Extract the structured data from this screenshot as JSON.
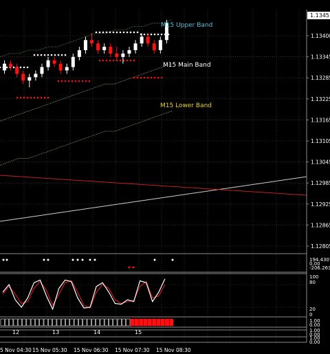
{
  "colors": {
    "background": "#000000",
    "grid": "#4a4a4a",
    "separator": "#8c8c8c",
    "text": "#ffffff",
    "bull": "#ffffff",
    "bear": "#ff1010",
    "upper_band_label": "#4fc3d8",
    "main_band_label": "#ffffff",
    "lower_band_label": "#e6d23a",
    "band_dots": "#c8c8a0",
    "trend_white": "#d0d0d0",
    "trend_red": "#c02020",
    "stoch_main": "#ffffff",
    "stoch_signal": "#d21a1a",
    "price_tag_bg": "#ffffff",
    "price_tag_text": "#000000"
  },
  "price_axis": {
    "current_price": "1.13457",
    "labels": [
      "1.13400",
      "1.13345",
      "1.13285",
      "1.13225",
      "1.13165",
      "1.13105",
      "1.13045",
      "1.12985",
      "1.12925",
      "1.12865",
      "1.12805"
    ]
  },
  "band_labels": {
    "upper": "M15 Upper Band",
    "main": "M15 Main Band",
    "lower": "M15 Lower Band"
  },
  "indicator_axis": {
    "cci_levels": [
      "194.4307",
      "0.00",
      "-206.263"
    ],
    "stoch_levels": [
      "100",
      "80",
      "20",
      "0"
    ],
    "bar_scale": [
      "1.00",
      "0.00"
    ],
    "empty1": [
      "1.00",
      "0.00"
    ],
    "empty2": [
      "1.00",
      "0.00"
    ]
  },
  "date_axis": {
    "day_labels": [
      "12",
      "13",
      "14",
      "15"
    ],
    "time_labels": [
      "5 Nov 04:30",
      "15 Nov 05:30",
      "15 Nov 06:30",
      "15 Nov 07:30",
      "15 Nov 08:30"
    ]
  },
  "chart_data": {
    "type": "candlestick",
    "symbol_timeframe": "M15",
    "ylim": [
      1.1277,
      1.1349
    ],
    "current_price": 1.13457,
    "candles": [
      [
        1.1331,
        1.1334,
        1.133,
        1.1333
      ],
      [
        1.1333,
        1.1334,
        1.1331,
        1.1332
      ],
      [
        1.1332,
        1.1333,
        1.1329,
        1.133
      ],
      [
        1.133,
        1.1331,
        1.1327,
        1.1328
      ],
      [
        1.1328,
        1.133,
        1.1326,
        1.1329
      ],
      [
        1.1329,
        1.1331,
        1.1328,
        1.133
      ],
      [
        1.133,
        1.1333,
        1.1329,
        1.1332
      ],
      [
        1.1332,
        1.1335,
        1.1331,
        1.1334
      ],
      [
        1.1334,
        1.1335,
        1.1332,
        1.1333
      ],
      [
        1.1333,
        1.1334,
        1.133,
        1.1331
      ],
      [
        1.1331,
        1.1333,
        1.133,
        1.1332
      ],
      [
        1.1332,
        1.1336,
        1.1331,
        1.1335
      ],
      [
        1.1335,
        1.1338,
        1.1334,
        1.1337
      ],
      [
        1.1337,
        1.1341,
        1.1336,
        1.134
      ],
      [
        1.134,
        1.1342,
        1.1338,
        1.1339
      ],
      [
        1.1339,
        1.134,
        1.1336,
        1.1337
      ],
      [
        1.1337,
        1.1339,
        1.1336,
        1.1338
      ],
      [
        1.1338,
        1.1339,
        1.1335,
        1.1336
      ],
      [
        1.1336,
        1.1338,
        1.1334,
        1.1335
      ],
      [
        1.1335,
        1.1337,
        1.1333,
        1.1336
      ],
      [
        1.1336,
        1.1338,
        1.1335,
        1.1337
      ],
      [
        1.1337,
        1.134,
        1.1336,
        1.1339
      ],
      [
        1.1339,
        1.1342,
        1.1338,
        1.1341
      ],
      [
        1.1341,
        1.1342,
        1.1338,
        1.1339
      ],
      [
        1.1339,
        1.134,
        1.1336,
        1.1337
      ],
      [
        1.1337,
        1.1341,
        1.1336,
        1.134
      ],
      [
        1.134,
        1.1346,
        1.1339,
        1.1345
      ]
    ],
    "upper_band": [
      1.1335,
      1.1336,
      1.1336,
      1.1337,
      1.1337,
      1.1338,
      1.1338,
      1.1339,
      1.134,
      1.1341,
      1.1342,
      1.1342,
      1.1343,
      1.1343,
      1.1344,
      1.1344,
      1.1345,
      1.1345,
      1.1346
    ],
    "main_band": [
      1.1316,
      1.1317,
      1.1318,
      1.1319,
      1.132,
      1.1321,
      1.1322,
      1.1323,
      1.1324,
      1.1325,
      1.1326,
      1.1327,
      1.1327,
      1.1328,
      1.1329,
      1.133,
      1.1331,
      1.1332,
      1.1333
    ],
    "lower_band": [
      1.1303,
      1.1304,
      1.1305,
      1.1305,
      1.1306,
      1.1307,
      1.1308,
      1.1309,
      1.131,
      1.1311,
      1.1312,
      1.1313,
      1.1313,
      1.1314,
      1.1315,
      1.1316,
      1.1317,
      1.1318,
      1.1319
    ],
    "trend_white": [
      [
        0,
        1.12885
      ],
      [
        1,
        1.12985
      ]
    ],
    "trend_red": [
      [
        0,
        1.12995
      ],
      [
        1,
        1.12965
      ]
    ],
    "stoch_main": [
      60,
      80,
      40,
      20,
      45,
      85,
      92,
      50,
      15,
      70,
      92,
      88,
      45,
      18,
      20,
      75,
      85,
      60,
      30,
      28,
      40,
      35,
      90,
      85,
      35,
      60,
      95
    ],
    "stoch_signal": [
      55,
      75,
      55,
      30,
      35,
      70,
      88,
      65,
      25,
      55,
      85,
      90,
      60,
      25,
      18,
      60,
      80,
      70,
      40,
      30,
      35,
      38,
      75,
      88,
      45,
      50,
      80
    ]
  }
}
